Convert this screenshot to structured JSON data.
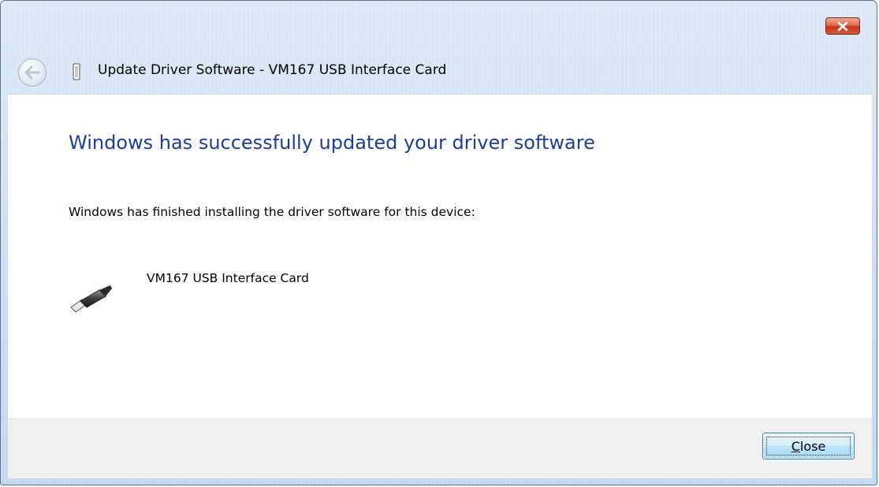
{
  "window": {
    "title": "Update Driver Software - VM167 USB Interface Card"
  },
  "titlebar": {
    "close_icon": "close-x-icon",
    "back_icon": "back-arrow-icon"
  },
  "content": {
    "headline": "Windows has successfully updated your driver software",
    "description": "Windows has finished installing the driver software for this device:",
    "device_name": "VM167 USB Interface Card",
    "device_icon": "usb-plug-icon"
  },
  "footer": {
    "close_label": "Close",
    "close_accelerator": "C",
    "close_rest": "lose"
  },
  "colors": {
    "headline": "#1e3d96",
    "titlebar_close": "#c7341c",
    "footer_bg": "#f0f0f0"
  }
}
